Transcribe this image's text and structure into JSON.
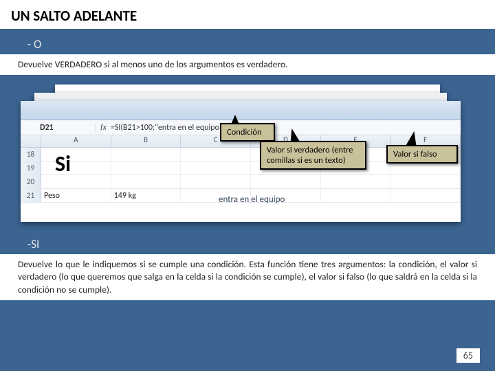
{
  "title": "UN SALTO ADELANTE",
  "section_o": {
    "heading": "- O",
    "description": "Devuelve VERDADERO si al menos uno de los argumentos es verdadero."
  },
  "section_si": {
    "heading": "-SI",
    "description": "Devuelve lo que le indiquemos si se cumple una condición. Esta función tiene tres argumentos: la condición, el valor si verdadero (lo que queremos que salga en la celda si la condición se cumple), el valor si falso (lo que saldrá en la celda si la condición no se cumple)."
  },
  "excel": {
    "cell_ref": "D21",
    "formula": "=SI(B21>100;\"entra en el equipo\";\"no entra\")",
    "columns": [
      "A",
      "B",
      "C",
      "D",
      "E",
      "F"
    ],
    "rows": [
      "18",
      "19",
      "20",
      "21"
    ],
    "big_label": "Si",
    "row21_a": "Peso",
    "row21_b": "149 kg",
    "row21_d": "entra en el equipo"
  },
  "callouts": {
    "condicion": "Condición",
    "verdadero": "Valor si verdadero (entre comillas si es un texto)",
    "falso": "Valor si falso"
  },
  "page_number": "65"
}
